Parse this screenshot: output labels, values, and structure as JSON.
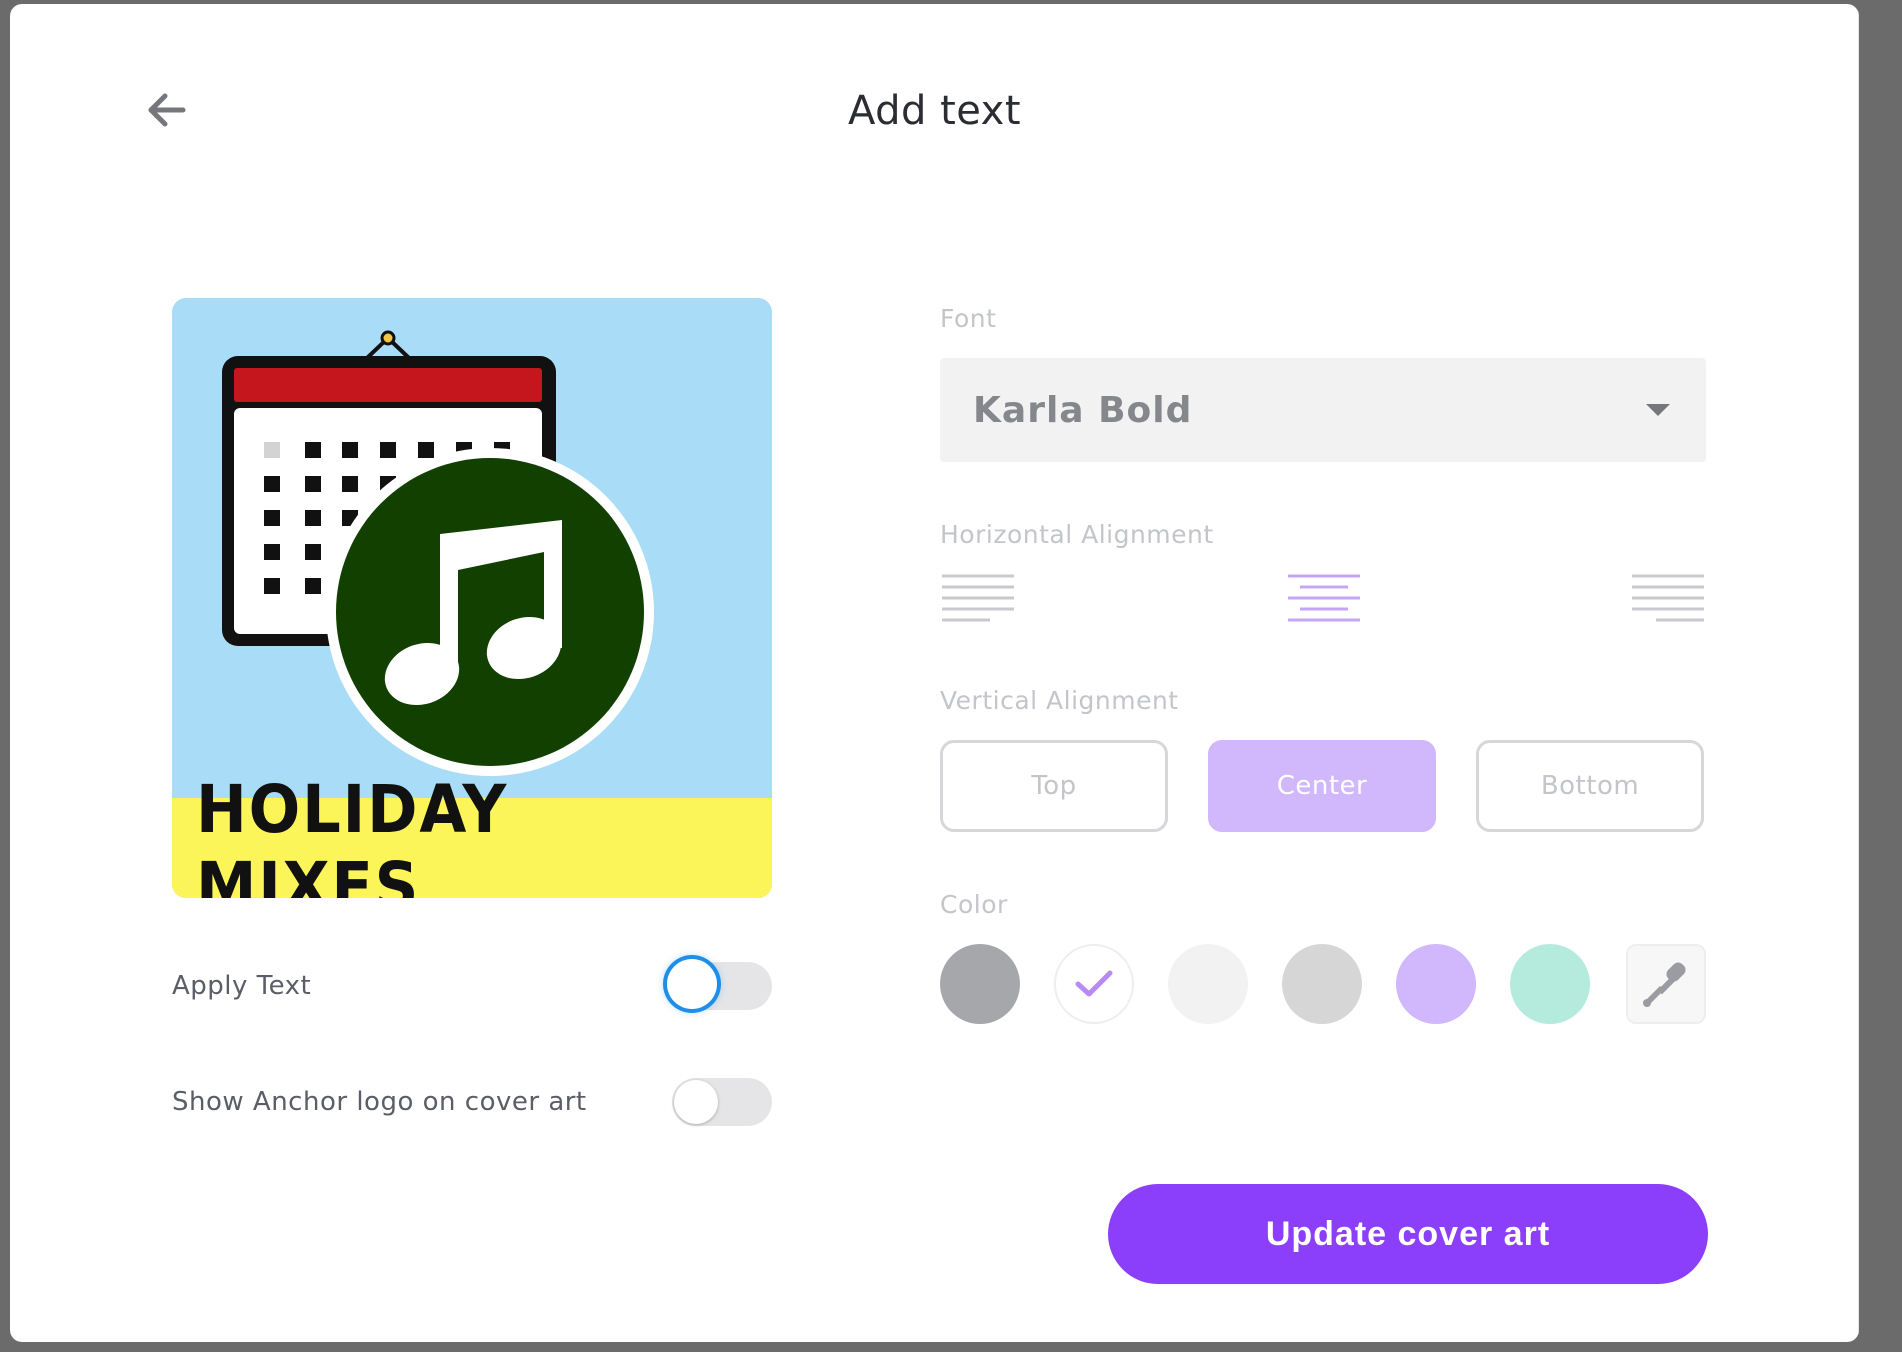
{
  "modal": {
    "title": "Add text",
    "back_icon": "arrow-left-icon"
  },
  "cover_art": {
    "caption": "HOLIDAY MIXES",
    "caption_band_color": "#fbf55a",
    "background_color": "#a8dcf7",
    "calendar_header_color": "#c4161c",
    "music_circle_color": "#114000"
  },
  "toggles": [
    {
      "label": "Apply Text",
      "on": false,
      "focused": true
    },
    {
      "label": "Show Anchor logo on cover art",
      "on": false,
      "focused": false
    }
  ],
  "font": {
    "label": "Font",
    "value": "Karla Bold",
    "caret_icon": "caret-down-icon"
  },
  "horizontal_alignment": {
    "label": "Horizontal Alignment",
    "options": [
      "left",
      "center",
      "right"
    ],
    "selected": "center"
  },
  "vertical_alignment": {
    "label": "Vertical Alignment",
    "options": [
      "Top",
      "Center",
      "Bottom"
    ],
    "selected": "Center"
  },
  "color": {
    "label": "Color",
    "swatches": [
      {
        "name": "dark-gray",
        "hex": "#a6a7ab"
      },
      {
        "name": "white",
        "hex": "#ffffff",
        "selected": true
      },
      {
        "name": "light-gray",
        "hex": "#f2f2f2"
      },
      {
        "name": "gray",
        "hex": "#d6d6d6"
      },
      {
        "name": "lavender",
        "hex": "#d1b7fb"
      },
      {
        "name": "mint",
        "hex": "#b4ebdd"
      }
    ],
    "picker_icon": "eyedropper-icon",
    "check_color": "#b98af5"
  },
  "actions": {
    "update_label": "Update cover art",
    "accent": "#8c3ffa"
  }
}
